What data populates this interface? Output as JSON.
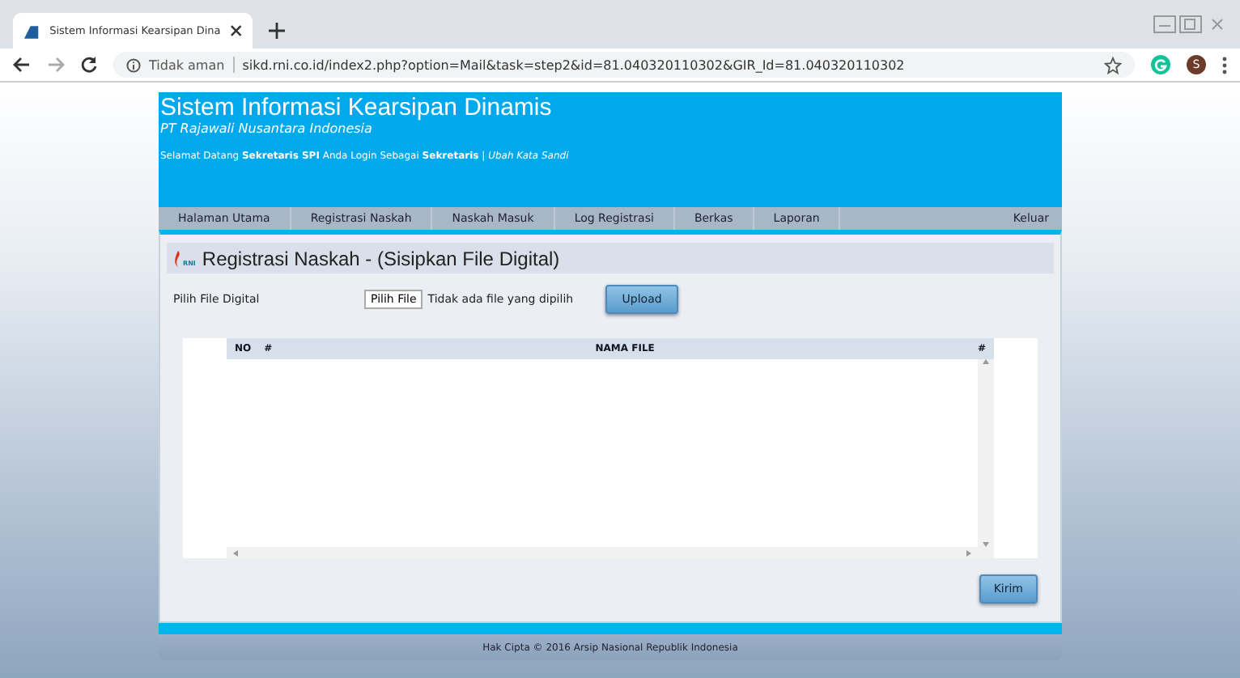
{
  "browser": {
    "tab_title": "Sistem Informasi Kearsipan Dina",
    "security": "Tidak aman",
    "url": "sikd.rni.co.id/index2.php?option=Mail&task=step2&id=81.040320110302&GIR_Id=81.040320110302",
    "profile_initial": "S"
  },
  "header": {
    "title": "Sistem Informasi Kearsipan Dinamis",
    "subtitle": "PT Rajawali Nusantara Indonesia",
    "welcome": "Selamat Datang **Sekretaris SPI** Anda Login Sebagai **Sekretaris** | *Ubah Kata Sandi*"
  },
  "nav": {
    "items": [
      "Halaman Utama",
      "Registrasi Naskah",
      "Naskah Masuk",
      "Log Registrasi",
      "Berkas",
      "Laporan"
    ],
    "logout": "Keluar"
  },
  "panel": {
    "logo_text": "RNI",
    "title": "Registrasi Naskah - (Sisipkan File Digital)",
    "file_label": "Pilih File Digital",
    "choose_button": "Pilih File",
    "no_file": "Tidak ada file yang dipilih",
    "upload_button": "Upload",
    "table": {
      "columns": [
        "NO",
        "#",
        "NAMA FILE",
        "#"
      ]
    },
    "submit_button": "Kirim"
  },
  "footer": "Hak Cipta © 2016 Arsip Nasional Republik Indonesia"
}
